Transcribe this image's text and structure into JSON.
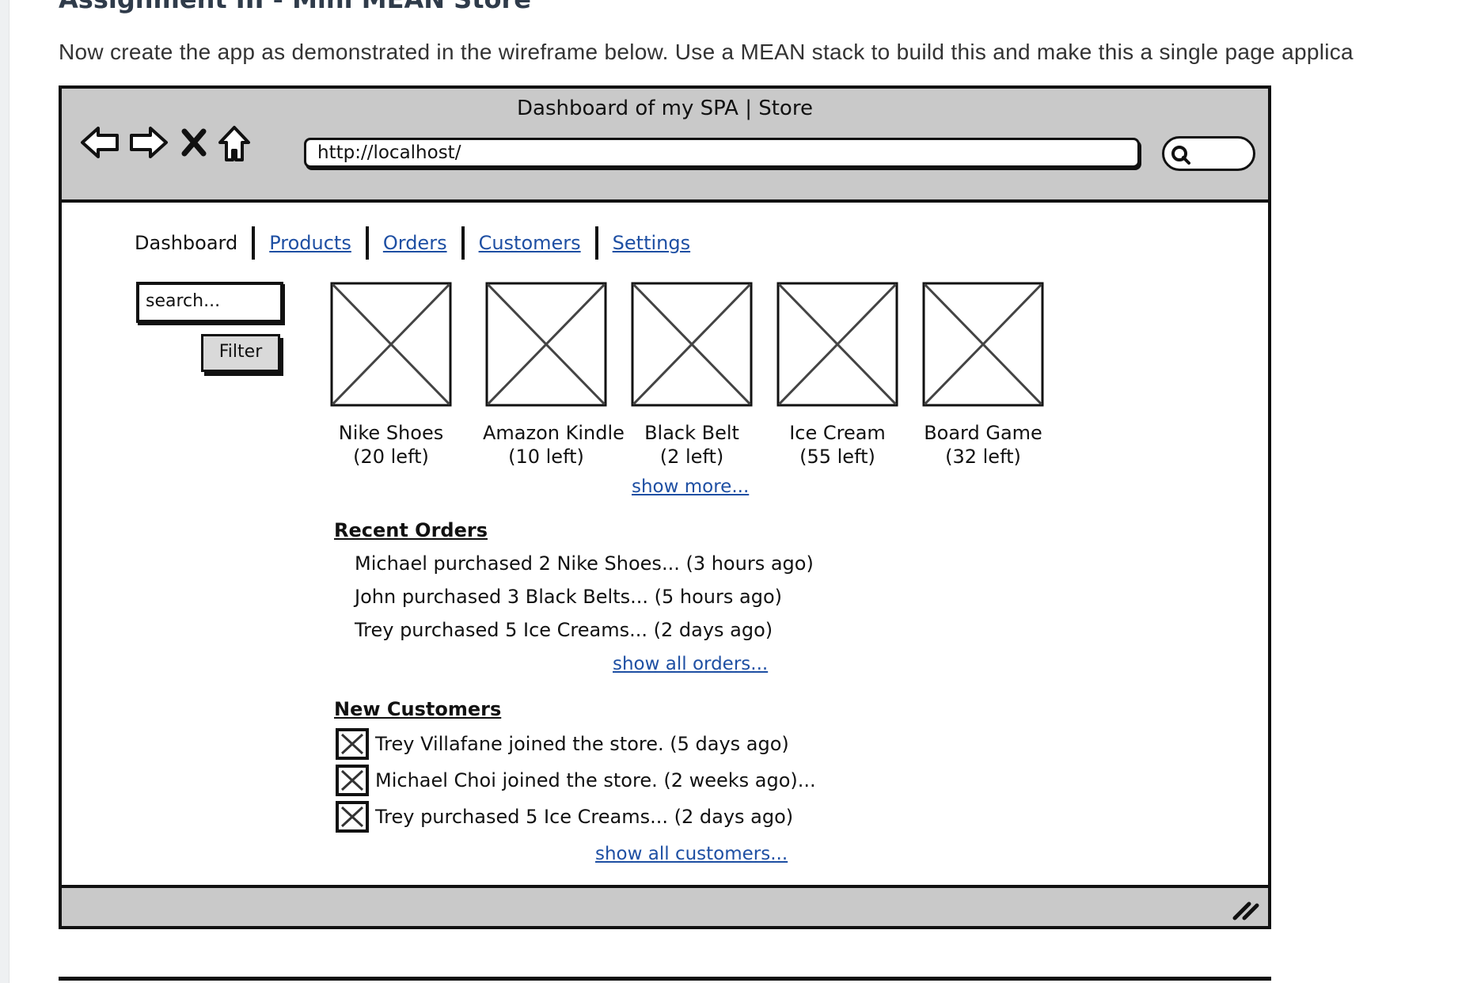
{
  "doc": {
    "heading": "Assignment III - Mini MEAN Store",
    "intro": "Now create the app as demonstrated in the wireframe below.  Use a MEAN stack to build this and make this a single page applica"
  },
  "window": {
    "title": "Dashboard of my SPA | Store",
    "url": "http://localhost/",
    "icons": [
      "back-arrow-icon",
      "forward-arrow-icon",
      "close-icon",
      "home-icon",
      "search-icon",
      "resize-grip-icon"
    ]
  },
  "nav": {
    "tabs": [
      {
        "label": "Dashboard",
        "active": true
      },
      {
        "label": "Products",
        "active": false
      },
      {
        "label": "Orders",
        "active": false
      },
      {
        "label": "Customers",
        "active": false
      },
      {
        "label": "Settings",
        "active": false
      }
    ]
  },
  "sidebar": {
    "search_placeholder": "search...",
    "filter_label": "Filter"
  },
  "products": {
    "items": [
      {
        "name": "Nike Shoes",
        "stock": "(20 left)"
      },
      {
        "name": "Amazon Kindle",
        "stock": "(10 left)"
      },
      {
        "name": "Black Belt",
        "stock": "(2 left)"
      },
      {
        "name": "Ice Cream",
        "stock": "(55 left)"
      },
      {
        "name": "Board Game",
        "stock": "(32 left)"
      }
    ],
    "show_more": "show more..."
  },
  "orders": {
    "title": "Recent Orders",
    "items": [
      "Michael purchased 2 Nike Shoes... (3 hours ago)",
      "John purchased 3 Black Belts... (5 hours ago)",
      "Trey purchased 5 Ice Creams... (2 days ago)"
    ],
    "show_all": "show all orders..."
  },
  "customers": {
    "title": "New Customers",
    "items": [
      "Trey Villafane joined the store. (5 days ago)",
      "Michael Choi joined the store. (2 weeks ago)...",
      "Trey purchased 5 Ice Creams... (2 days ago)"
    ],
    "show_all": "show all customers..."
  }
}
